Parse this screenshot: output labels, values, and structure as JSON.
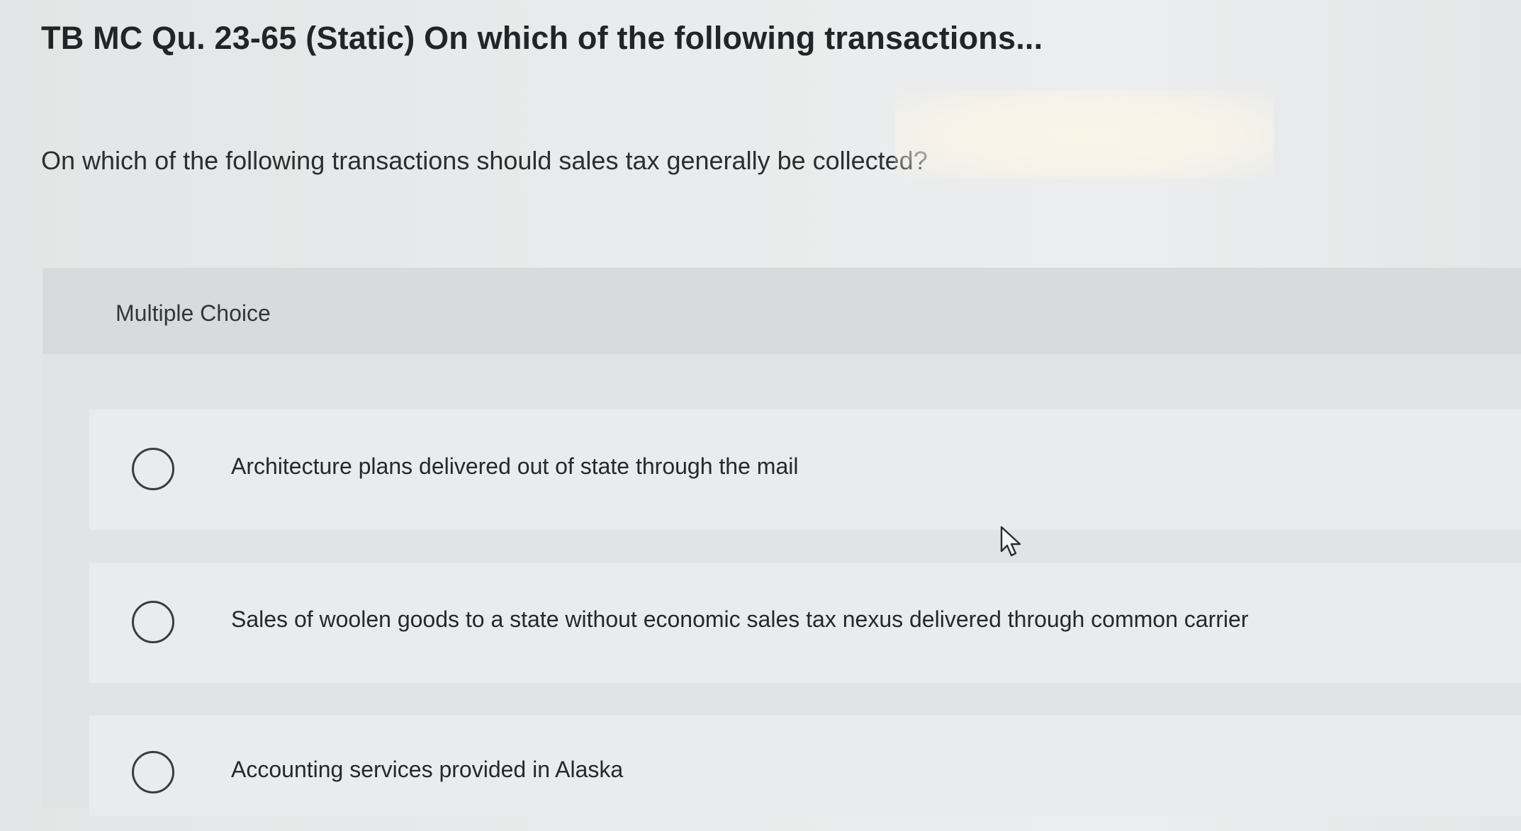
{
  "header": {
    "title": "TB MC Qu. 23-65 (Static) On which of the following transactions..."
  },
  "question": {
    "text": "On which of the following transactions should sales tax generally be collected?"
  },
  "multiple_choice": {
    "label": "Multiple Choice",
    "options": [
      {
        "label": "Architecture plans delivered out of state through the mail",
        "selected": false
      },
      {
        "label": "Sales of woolen goods to a state without economic sales tax nexus delivered through common carrier",
        "selected": false
      },
      {
        "label": "Accounting services provided in Alaska",
        "selected": false
      }
    ]
  },
  "icons": {
    "radio": "radio-button-icon",
    "pointer": "mouse-pointer-icon"
  }
}
